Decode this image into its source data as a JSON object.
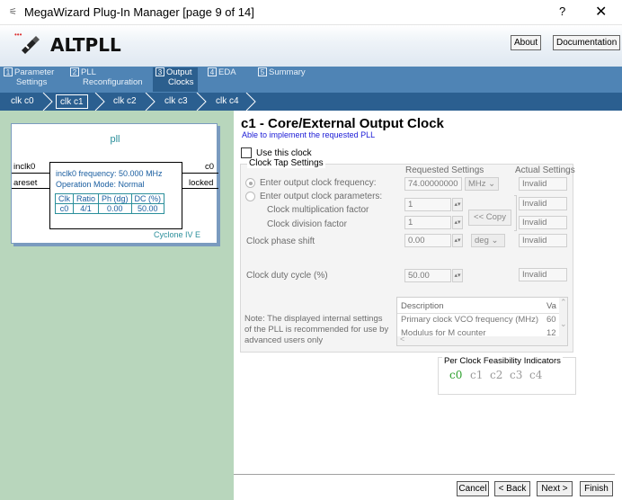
{
  "window": {
    "title": "MegaWizard Plug-In Manager [page 9 of 14]",
    "help_glyph": "?",
    "close_glyph": "✕"
  },
  "header": {
    "logo_text": "ALTPLL",
    "about_label": "About",
    "documentation_label": "Documentation"
  },
  "tabs": [
    {
      "num": "1",
      "label1": "Parameter",
      "label2": "Settings"
    },
    {
      "num": "2",
      "label1": "PLL",
      "label2": "Reconfiguration"
    },
    {
      "num": "3",
      "label1": "Output",
      "label2": "Clocks"
    },
    {
      "num": "4",
      "label1": "EDA",
      "label2": ""
    },
    {
      "num": "5",
      "label1": "Summary",
      "label2": ""
    }
  ],
  "active_tab": 2,
  "clocks": [
    "clk c0",
    "clk c1",
    "clk c2",
    "clk c3",
    "clk c4"
  ],
  "selected_clock": 1,
  "diagram": {
    "name": "pll",
    "in_pins": [
      "inclk0",
      "areset"
    ],
    "out_pins": [
      "c0",
      "locked"
    ],
    "freq_text": "inclk0 frequency: 50.000 MHz",
    "mode_text": "Operation Mode: Normal",
    "table_headers": [
      "Clk",
      "Ratio",
      "Ph (dg)",
      "DC (%)"
    ],
    "table_row": [
      "c0",
      "4/1",
      "0.00",
      "50.00"
    ],
    "device": "Cyclone IV E"
  },
  "panel": {
    "title": "c1 - Core/External Output Clock",
    "subtitle": "Able to implement the requested PLL",
    "use_clock_label": "Use this clock",
    "group_label": "Clock Tap Settings",
    "requested_header": "Requested Settings",
    "actual_header": "Actual Settings",
    "enter_freq_label": "Enter output clock frequency:",
    "freq_value": "74.00000000",
    "freq_unit": "MHz",
    "freq_actual": "Invalid",
    "enter_params_label": "Enter output clock parameters:",
    "mult_label": "Clock multiplication factor",
    "mult_value": "1",
    "mult_actual": "Invalid",
    "div_label": "Clock division factor",
    "div_value": "1",
    "div_actual": "Invalid",
    "copy_label": "<< Copy",
    "phase_label": "Clock phase shift",
    "phase_value": "0.00",
    "phase_unit": "deg",
    "phase_actual": "Invalid",
    "duty_label": "Clock duty cycle (%)",
    "duty_value": "50.00",
    "duty_actual": "Invalid",
    "note": [
      "Note: The displayed internal settings",
      "of the PLL is recommended for use by",
      "advanced users only"
    ],
    "list_headers": [
      "Description",
      "Va"
    ],
    "list_rows": [
      {
        "desc": "Primary clock VCO frequency (MHz)",
        "val": "60"
      },
      {
        "desc": "Modulus for M counter",
        "val": "12"
      }
    ],
    "feas_label": "Per Clock Feasibility Indicators",
    "feas_clocks": [
      "c0",
      "c1",
      "c2",
      "c3",
      "c4"
    ]
  },
  "colors": {
    "feasible": "#2ca02c",
    "infeasible": "#9a9a9a",
    "title_blue": "#1a1ad6"
  },
  "nav": {
    "cancel": "Cancel",
    "back": "< Back",
    "next": "Next >",
    "finish": "Finish"
  }
}
